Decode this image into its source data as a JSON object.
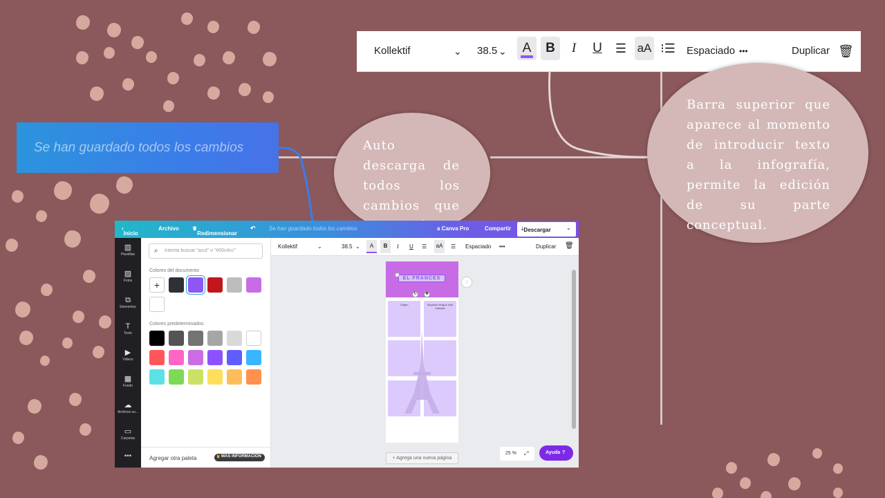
{
  "toolbar": {
    "font": "Kollektif",
    "size": "38.5",
    "text_color_icon": "A",
    "bold": "B",
    "italic": "I",
    "underline": "U",
    "case": "aA",
    "spacing": "Espaciado",
    "more": "•••",
    "duplicate": "Duplicar"
  },
  "saved_banner": "Se han guardado todos los cambios",
  "callouts": {
    "autosave": "Auto descarga de todos los cambios que se realizan.",
    "topbar": "Barra superior que aparece al momento de introducir texto a la infografía, permite la edición de su parte conceptual."
  },
  "editor": {
    "topbar": {
      "home": "Inicio",
      "file": "Archivo",
      "resize": "Redimensionar",
      "saved": "Se han guardado todos los cambios",
      "pro": "a Canva Pro",
      "share": "Compartir",
      "download": "Descargar"
    },
    "rail": [
      "Plantillas",
      "Fotos",
      "Elementos",
      "Texto",
      "Videos",
      "Fondo",
      "Archivos su...",
      "Carpetas"
    ],
    "panel": {
      "search_placeholder": "Intenta buscar \"azul\" o \"#00c4cc\"",
      "doc_colors_title": "Colores del documento",
      "preset_colors_title": "Colores predeterminados",
      "add_palette": "Agregar otra paleta",
      "more_info": "MÁS INFORMACIÓN"
    },
    "toolbar": {
      "font": "Kollektif",
      "size": "38.5",
      "spacing": "Espaciado",
      "duplicate": "Duplicar"
    },
    "canvas": {
      "title": "EL FRANCES",
      "cell1": "Origen",
      "cell2": "Segundo lengua más hablada"
    },
    "add_page": "+ Agrega una nueva página",
    "zoom": "25 %",
    "help": "Ayuda",
    "help_q": "?"
  },
  "colors": {
    "background": "#8b585b",
    "dots": "#d6a99e",
    "oval": "#d3b8b7",
    "doc": [
      "#2f2f36",
      "#8b57f5",
      "#c0161c",
      "#bdbdbd",
      "#c86ce6"
    ],
    "preset": [
      "#000000",
      "#545454",
      "#737373",
      "#a6a6a6",
      "#d9d9d9",
      "#ffffff",
      "#ff5757",
      "#ff66c4",
      "#cb6ce6",
      "#8c52ff",
      "#5e5eff",
      "#38b6ff",
      "#5ce1e6",
      "#7ed957",
      "#c9e265",
      "#ffde59",
      "#ffbd59",
      "#ff914d"
    ]
  }
}
